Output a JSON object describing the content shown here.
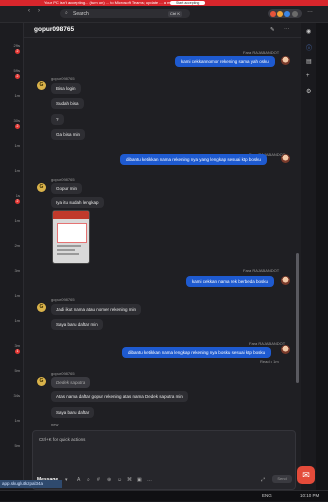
{
  "banner": {
    "text": "Your PC isn't accepting... (turn on) ... to Microsoft Teams; update ... a message",
    "button": "Start accepting"
  },
  "topbar": {
    "search_placeholder": "Search",
    "shortcut": "Ctrl",
    "shortcut_key": "K",
    "icons": [
      "back-icon",
      "forward-icon",
      "search-icon",
      "more-icon"
    ]
  },
  "left_list": [
    {
      "time": "29s",
      "badge": "2"
    },
    {
      "time": "59s",
      "badge": "2"
    },
    {
      "time": "1m",
      "badge": ""
    },
    {
      "time": "30s",
      "badge": "2"
    },
    {
      "time": "1m",
      "badge": ""
    },
    {
      "time": "1m",
      "badge": ""
    },
    {
      "time": "1s",
      "badge": "2"
    },
    {
      "time": "1m",
      "badge": ""
    },
    {
      "time": "2m",
      "badge": ""
    },
    {
      "time": "3m",
      "badge": ""
    },
    {
      "time": "1m",
      "badge": ""
    },
    {
      "time": "1m",
      "badge": ""
    },
    {
      "time": "3m",
      "badge": "1"
    },
    {
      "time": "5m",
      "badge": ""
    },
    {
      "time": "34s",
      "badge": ""
    },
    {
      "time": "1m",
      "badge": ""
    },
    {
      "time": "5m",
      "badge": ""
    }
  ],
  "chat": {
    "title": "gopur098765",
    "agent_name": "Fara RAJABANDOT",
    "user_name": "gopur098765",
    "messages": [
      {
        "who": "agent",
        "text": "kami cekkannomor rekening sama yah osku"
      },
      {
        "who": "user",
        "lines": [
          "Bisa login",
          "Sudah bisa",
          "?",
          "Ga bisa min"
        ]
      },
      {
        "who": "agent",
        "text": "dibantu ketikkan nama rekening nya yang lengkap sesuai ktp bosku"
      },
      {
        "who": "user",
        "lines": [
          "Gopur min",
          "Iya itu sudah lengkap"
        ]
      },
      {
        "who": "agent",
        "text": "kami cekkan nama rek berbeda bosku"
      },
      {
        "who": "user",
        "lines": [
          "Jadi ikut nama atau nomer rekening min",
          "Saya baru daftar min"
        ]
      },
      {
        "who": "agent",
        "text": "dibantu ketikkan nama lengkap rekening nya bosku sesuai ktp bosku",
        "status": "Read • 1m"
      },
      {
        "who": "user",
        "quoted": "Dedek saputra",
        "lines": [
          "Atas nama daftar gopur rekening atas nama Dedek saputra min",
          "Saya baru daftar"
        ],
        "extra": "new"
      }
    ]
  },
  "composer": {
    "placeholder": "Ctrl+K for quick actions",
    "type_label": "Message",
    "send_label": "Send",
    "add_tag": "Add tag"
  },
  "url_bar": "app.skuglutkzpal34a",
  "tray": {
    "lang": "ENG",
    "time": "10:10 PM"
  },
  "colors": {
    "accent": "#1e5ad0",
    "badge": "#e53935",
    "banner": "#d8262c"
  }
}
